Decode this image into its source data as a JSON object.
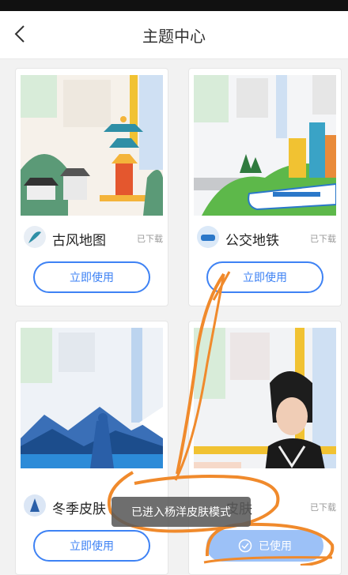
{
  "header": {
    "title": "主题中心"
  },
  "themes": [
    {
      "name": "古风地图",
      "status": "已下载",
      "button": "立即使用"
    },
    {
      "name": "公交地铁",
      "status": "已下载",
      "button": "立即使用"
    },
    {
      "name": "冬季皮肤",
      "button": "立即使用"
    },
    {
      "name": "皮肤",
      "status": "已下载",
      "button": "已使用"
    }
  ],
  "toast": "已进入杨洋皮肤模式",
  "colors": {
    "accent": "#3e82f4",
    "annotation": "#f08a2c"
  }
}
